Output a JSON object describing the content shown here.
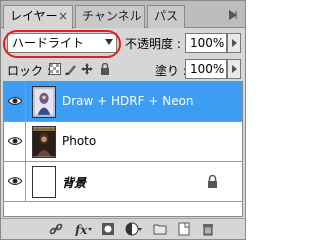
{
  "tabs": [
    {
      "label": "レイヤー",
      "close": "×",
      "active": true
    },
    {
      "label": "チャンネル",
      "active": false
    },
    {
      "label": "パス",
      "active": false
    }
  ],
  "blend_mode": {
    "value": "ハードライト",
    "highlight_color": "#e12020"
  },
  "opacity": {
    "label": "不透明度 :",
    "value": "100%"
  },
  "lock": {
    "label": "ロック :",
    "icons": [
      "lock-transparent-icon",
      "lock-image-icon",
      "lock-position-icon",
      "lock-all-icon"
    ]
  },
  "fill": {
    "label": "塗り :",
    "value": "100%"
  },
  "layers": [
    {
      "name": "Draw + HDRF + Neon",
      "selected": true,
      "visible": true,
      "locked": false
    },
    {
      "name": "Photo",
      "selected": false,
      "visible": true,
      "locked": false
    },
    {
      "name": "背景",
      "selected": false,
      "visible": true,
      "locked": true
    }
  ],
  "colors": {
    "selection": "#3d9df2",
    "panel": "#d6d6d6"
  },
  "bottom_icons": [
    "link-icon",
    "fx-icon",
    "mask-icon",
    "adjustment-icon",
    "group-folder-icon",
    "new-layer-icon",
    "trash-icon"
  ]
}
